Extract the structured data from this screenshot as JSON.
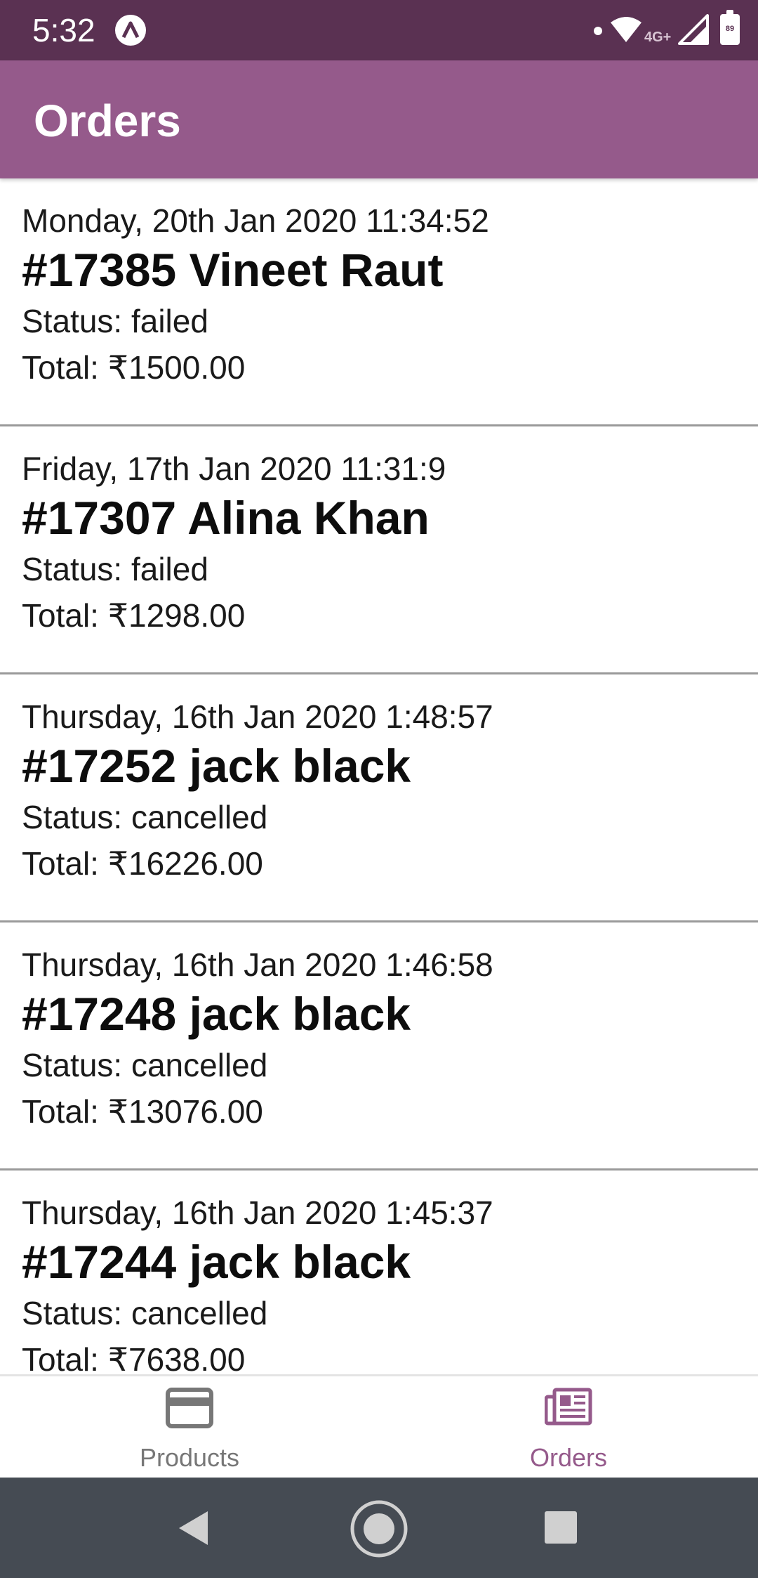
{
  "status_bar": {
    "time": "5:32",
    "app_icon": "a-icon",
    "network_type": "4G+",
    "battery_level": "89",
    "icons": [
      "notification-dot",
      "wifi-icon",
      "signal-icon",
      "battery-icon"
    ]
  },
  "app_bar": {
    "title": "Orders"
  },
  "orders": [
    {
      "date": "Monday, 20th Jan 2020 11:34:52",
      "title": "#17385 Vineet Raut",
      "status": "Status: failed",
      "total": "Total: ₹1500.00"
    },
    {
      "date": "Friday, 17th Jan 2020 11:31:9",
      "title": "#17307 Alina Khan",
      "status": "Status: failed",
      "total": "Total: ₹1298.00"
    },
    {
      "date": "Thursday, 16th Jan 2020 1:48:57",
      "title": "#17252 jack black",
      "status": "Status: cancelled",
      "total": "Total: ₹16226.00"
    },
    {
      "date": "Thursday, 16th Jan 2020 1:46:58",
      "title": "#17248 jack black",
      "status": "Status: cancelled",
      "total": "Total: ₹13076.00"
    },
    {
      "date": "Thursday, 16th Jan 2020 1:45:37",
      "title": "#17244 jack black",
      "status": "Status: cancelled",
      "total": "Total: ₹7638.00"
    }
  ],
  "bottom_nav": {
    "products_label": "Products",
    "products_icon": "credit-card-icon",
    "orders_label": "Orders",
    "orders_icon": "newspaper-icon",
    "active_tab": "Orders"
  },
  "system_nav": {
    "icons": [
      "back-icon",
      "home-icon",
      "recents-icon"
    ]
  },
  "colors": {
    "status_bar": "#5a3152",
    "app_bar": "#955a8b",
    "accent": "#955a8b",
    "inactive": "#777777",
    "system_nav": "#454b53"
  }
}
